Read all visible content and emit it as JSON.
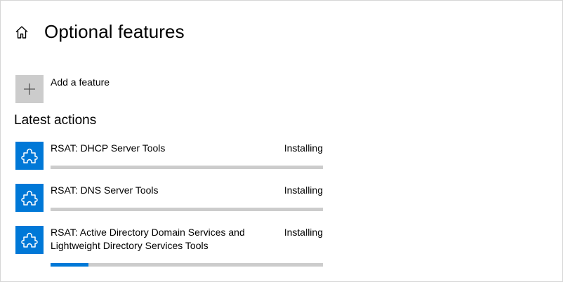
{
  "header": {
    "title": "Optional features",
    "home_icon": "home-icon"
  },
  "add_feature": {
    "label": "Add a feature",
    "icon": "plus-icon",
    "tile_color": "#cccccc"
  },
  "latest_actions": {
    "title": "Latest actions",
    "items": [
      {
        "name": "RSAT: DHCP Server Tools",
        "status": "Installing",
        "progress": 0.0,
        "icon": "puzzle-icon"
      },
      {
        "name": "RSAT: DNS Server Tools",
        "status": "Installing",
        "progress": 0.0,
        "icon": "puzzle-icon"
      },
      {
        "name": "RSAT: Active Directory Domain Services and Lightweight Directory Services Tools",
        "status": "Installing",
        "progress": 0.14,
        "icon": "puzzle-icon"
      }
    ]
  },
  "colors": {
    "accent": "#0078d7",
    "track": "#cccccc"
  }
}
